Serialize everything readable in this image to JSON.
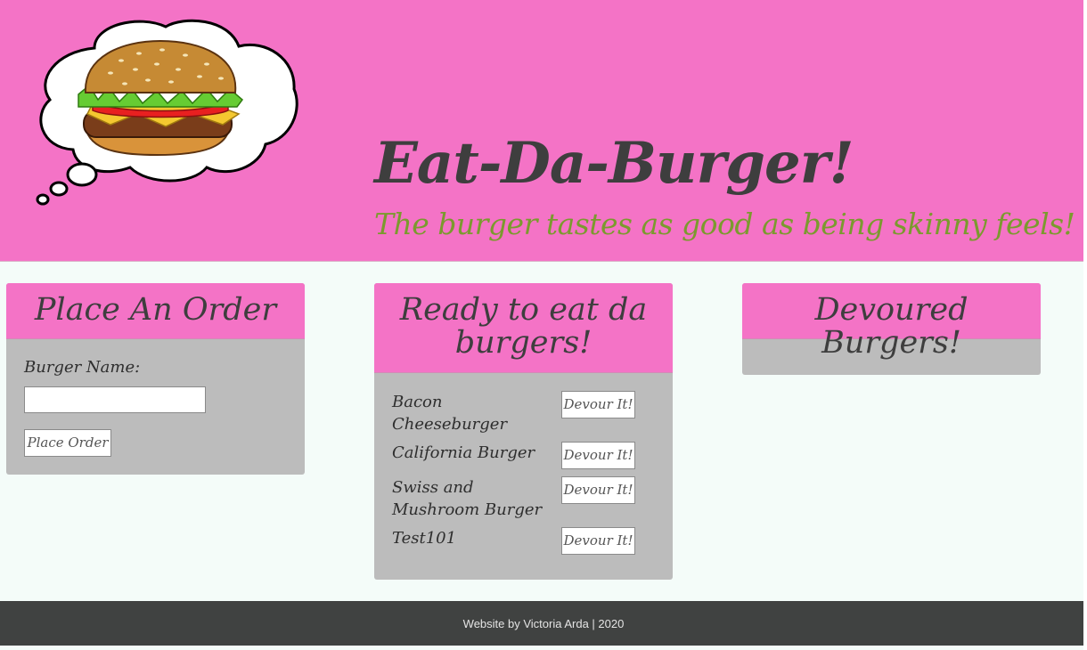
{
  "header": {
    "title": "Eat-Da-Burger!",
    "tagline": "The burger tastes as good as being skinny feels!"
  },
  "order_card": {
    "title": "Place An Order",
    "label": "Burger Name:",
    "input_value": "",
    "button": "Place Order"
  },
  "ready_card": {
    "title": "Ready to eat da burgers!",
    "burgers": [
      {
        "name": "Bacon Cheeseburger",
        "button": "Devour It!"
      },
      {
        "name": "California Burger",
        "button": "Devour It!"
      },
      {
        "name": "Swiss and Mushroom Burger",
        "button": "Devour It!"
      },
      {
        "name": "Test101",
        "button": "Devour It!"
      }
    ]
  },
  "devoured_card": {
    "title": "Devoured Burgers!",
    "burgers": []
  },
  "footer": {
    "text": "Website by Victoria Arda | 2020"
  },
  "colors": {
    "header_bg": "#f473c6",
    "tagline": "#7b9a2e",
    "card_body": "#bcbcbc",
    "footer_bg": "#404241",
    "page_bg": "#f4fcf9"
  },
  "icons": {
    "logo": "burger-thought-bubble-icon"
  }
}
